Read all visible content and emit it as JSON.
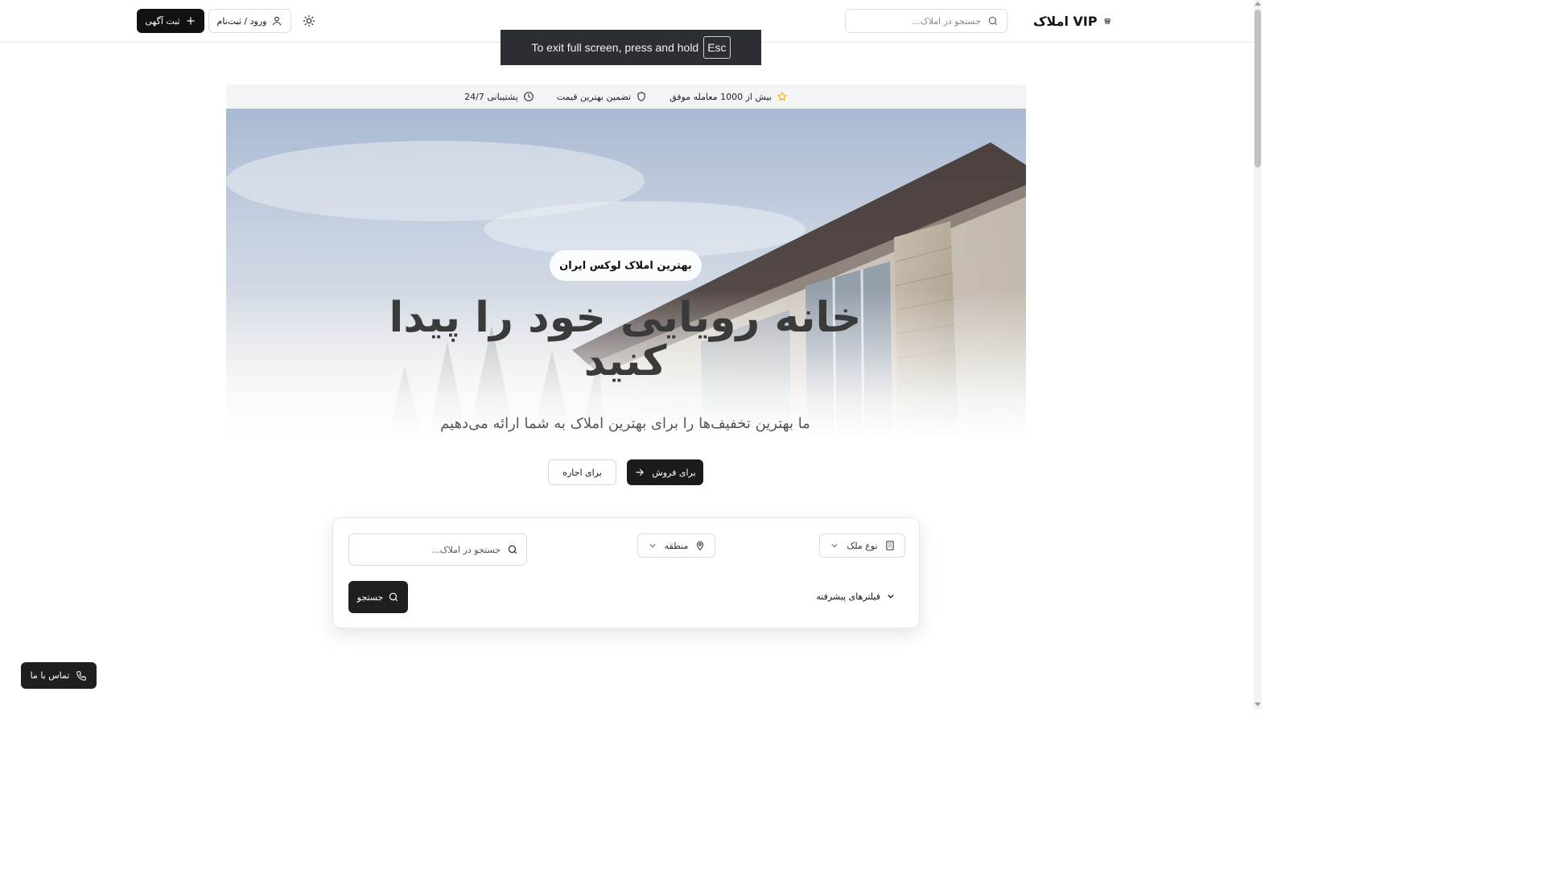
{
  "header": {
    "brand_text": "VIP املاک",
    "brand_icon": "store-icon",
    "search_placeholder": "جستجو در املاک...",
    "theme_icon": "sun-icon",
    "login_label": "ورود / ثبت‌نام",
    "post_ad_label": "ثبت آگهی"
  },
  "fullscreen_toast": {
    "text": "To exit full screen, press and hold",
    "key": "Esc"
  },
  "features": [
    {
      "label": "بیش از 1000 معامله موفق",
      "icon": "star-icon",
      "color": "#f5b301"
    },
    {
      "label": "تضمین بهترین قیمت",
      "icon": "shield-icon"
    },
    {
      "label": "پشتیبانی 24/7",
      "icon": "clock-icon"
    }
  ],
  "hero": {
    "tagline": "بهترین املاک لوکس ایران",
    "title": "خانه رویایی خود را پیدا کنید",
    "subtitle": "ما بهترین تخفیف‌ها را برای بهترین املاک به شما ارائه می‌دهیم",
    "sale_label": "برای فروش",
    "rent_label": "برای اجاره"
  },
  "search_panel": {
    "property_type_label": "نوع ملک",
    "region_label": "منطقه",
    "search_placeholder": "جستجو در املاک...",
    "advanced_filters_label": "فیلترهای پیشرفته",
    "search_button_label": "جستجو"
  },
  "contact": {
    "label": "تماس با ما"
  },
  "colors": {
    "primary": "#111111",
    "accent_star": "#f5b301",
    "feature_bar_bg": "#f3f4f6"
  }
}
